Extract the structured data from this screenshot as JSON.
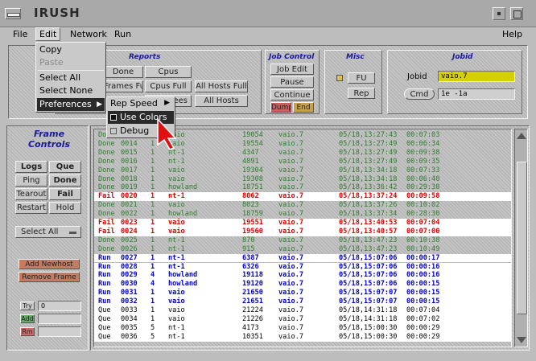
{
  "window": {
    "title": "IRUSH"
  },
  "menubar": {
    "file": "File",
    "edit": "Edit",
    "network": "Network",
    "run": "Run",
    "help": "Help"
  },
  "edit_menu": {
    "copy": "Copy",
    "paste": "Paste",
    "select_all": "Select All",
    "select_none": "Select None",
    "preferences": "Preferences",
    "arrow": "▶"
  },
  "prefs_menu": {
    "rep_speed": "Rep Speed",
    "arrow": "▶",
    "use_colors": "Use Colors",
    "debug": "Debug"
  },
  "reports": {
    "title": "Reports",
    "done": "Done",
    "cpus": "Cpus",
    "frames_full": "Frames Full",
    "cpus_full": "Cpus Full",
    "all_hosts_full": "All Hosts Full",
    "all_hosts": "All Hosts",
    "trees": "Trees"
  },
  "job_control": {
    "title": "Job Control",
    "job_edit": "Job Edit",
    "pause": "Pause",
    "continue": "Continue",
    "dump": "Dump",
    "end": "End"
  },
  "misc": {
    "title": "Misc",
    "fu": "FU",
    "rep": "Rep"
  },
  "jobid": {
    "title": "Jobid",
    "label": "Jobid",
    "value": "vaio.7",
    "cmd_label": "Cmd",
    "cmd_value": "1e -1a"
  },
  "frame_controls": {
    "title": "Frame Controls",
    "logs": "Logs",
    "que": "Que",
    "ping": "Ping",
    "done": "Done",
    "tearout": "Tearout",
    "fail": "Fail",
    "restart": "Restart",
    "hold": "Hold",
    "select_all": "Select All",
    "add_newhost": "Add Newhost",
    "remove_frame": "Remove Frame",
    "try_label": "Try",
    "try_value": "0",
    "add": "Add",
    "rm": "Rm"
  },
  "colors": {
    "done": "#2e7d2e",
    "fail": "#dd0000",
    "run": "#0000cc",
    "que": "#000000"
  },
  "jobs": [
    {
      "status": "Done",
      "jid": "0013",
      "n": "1",
      "host": "vaio",
      "pid": "19054",
      "mach": "vaio.7",
      "date": "05/18,13:27:43",
      "elap": "00:07:03",
      "kind": "done"
    },
    {
      "status": "Done",
      "jid": "0014",
      "n": "1",
      "host": "vaio",
      "pid": "19554",
      "mach": "vaio.7",
      "date": "05/18,13:27:49",
      "elap": "00:06:34",
      "kind": "done"
    },
    {
      "status": "Done",
      "jid": "0015",
      "n": "1",
      "host": "nt-1",
      "pid": "4347",
      "mach": "vaio.7",
      "date": "05/18,13:27:49",
      "elap": "00:09:38",
      "kind": "done"
    },
    {
      "status": "Done",
      "jid": "0016",
      "n": "1",
      "host": "nt-1",
      "pid": "4891",
      "mach": "vaio.7",
      "date": "05/18,13:27:49",
      "elap": "00:09:35",
      "kind": "done"
    },
    {
      "status": "Done",
      "jid": "0017",
      "n": "1",
      "host": "vaio",
      "pid": "19304",
      "mach": "vaio.7",
      "date": "05/18,13:34:18",
      "elap": "00:07:33",
      "kind": "done"
    },
    {
      "status": "Done",
      "jid": "0018",
      "n": "1",
      "host": "vaio",
      "pid": "19308",
      "mach": "vaio.7",
      "date": "05/18,13:34:18",
      "elap": "00:06:40",
      "kind": "done"
    },
    {
      "status": "Done",
      "jid": "0019",
      "n": "1",
      "host": "howland",
      "pid": "18751",
      "mach": "vaio.7",
      "date": "05/18,13:36:42",
      "elap": "00:29:38",
      "kind": "done"
    },
    {
      "status": "Fail",
      "jid": "0020",
      "n": "1",
      "host": "nt-1",
      "pid": "8062",
      "mach": "vaio.7",
      "date": "05/18,13:37:24",
      "elap": "00:09:58",
      "kind": "fail"
    },
    {
      "status": "Done",
      "jid": "0021",
      "n": "1",
      "host": "vaio",
      "pid": "8023",
      "mach": "vaio.7",
      "date": "05/18,13:37:26",
      "elap": "00:10:02",
      "kind": "done"
    },
    {
      "status": "Done",
      "jid": "0022",
      "n": "1",
      "host": "howland",
      "pid": "18759",
      "mach": "vaio.7",
      "date": "05/18,13:37:34",
      "elap": "00:28:30",
      "kind": "done"
    },
    {
      "status": "Fail",
      "jid": "0023",
      "n": "1",
      "host": "vaio",
      "pid": "19551",
      "mach": "vaio.7",
      "date": "05/18,13:40:53",
      "elap": "00:07:04",
      "kind": "fail"
    },
    {
      "status": "Fail",
      "jid": "0024",
      "n": "1",
      "host": "vaio",
      "pid": "19560",
      "mach": "vaio.7",
      "date": "05/18,13:40:57",
      "elap": "00:07:00",
      "kind": "fail"
    },
    {
      "status": "Done",
      "jid": "0025",
      "n": "1",
      "host": "nt-1",
      "pid": "870",
      "mach": "vaio.7",
      "date": "05/18,13:47:23",
      "elap": "00:10:38",
      "kind": "done"
    },
    {
      "status": "Done",
      "jid": "0026",
      "n": "1",
      "host": "nt-1",
      "pid": "915",
      "mach": "vaio.7",
      "date": "05/18,13:47:23",
      "elap": "00:10:49",
      "kind": "done"
    },
    {
      "status": "Run",
      "jid": "0027",
      "n": "1",
      "host": "nt-1",
      "pid": "6387",
      "mach": "vaio.7",
      "date": "05/18,15:07:06",
      "elap": "00:00:17",
      "kind": "run"
    },
    {
      "status": "Run",
      "jid": "0028",
      "n": "1",
      "host": "nt-1",
      "pid": "6326",
      "mach": "vaio.7",
      "date": "05/18,15:07:06",
      "elap": "00:00:16",
      "kind": "run"
    },
    {
      "status": "Run",
      "jid": "0029",
      "n": "4",
      "host": "howland",
      "pid": "19118",
      "mach": "vaio.7",
      "date": "05/18,15:07:06",
      "elap": "00:00:16",
      "kind": "run"
    },
    {
      "status": "Run",
      "jid": "0030",
      "n": "4",
      "host": "howland",
      "pid": "19120",
      "mach": "vaio.7",
      "date": "05/18,15:07:06",
      "elap": "00:00:15",
      "kind": "run"
    },
    {
      "status": "Run",
      "jid": "0031",
      "n": "1",
      "host": "vaio",
      "pid": "21650",
      "mach": "vaio.7",
      "date": "05/18,15:07:07",
      "elap": "00:00:15",
      "kind": "run"
    },
    {
      "status": "Run",
      "jid": "0032",
      "n": "1",
      "host": "vaio",
      "pid": "21651",
      "mach": "vaio.7",
      "date": "05/18,15:07:07",
      "elap": "00:00:15",
      "kind": "run"
    },
    {
      "status": "Que",
      "jid": "0033",
      "n": "1",
      "host": "vaio",
      "pid": "21224",
      "mach": "vaio.7",
      "date": "05/18,14:31:18",
      "elap": "00:07:04",
      "kind": "que"
    },
    {
      "status": "Que",
      "jid": "0034",
      "n": "1",
      "host": "vaio",
      "pid": "21226",
      "mach": "vaio.7",
      "date": "05/18,14:31:18",
      "elap": "00:07:02",
      "kind": "que"
    },
    {
      "status": "Que",
      "jid": "0035",
      "n": "5",
      "host": "nt-1",
      "pid": "4173",
      "mach": "vaio.7",
      "date": "05/18,15:00:30",
      "elap": "00:00:29",
      "kind": "que"
    },
    {
      "status": "Que",
      "jid": "0036",
      "n": "5",
      "host": "nt-1",
      "pid": "10351",
      "mach": "vaio.7",
      "date": "05/18,15:00:30",
      "elap": "00:00:29",
      "kind": "que"
    }
  ]
}
